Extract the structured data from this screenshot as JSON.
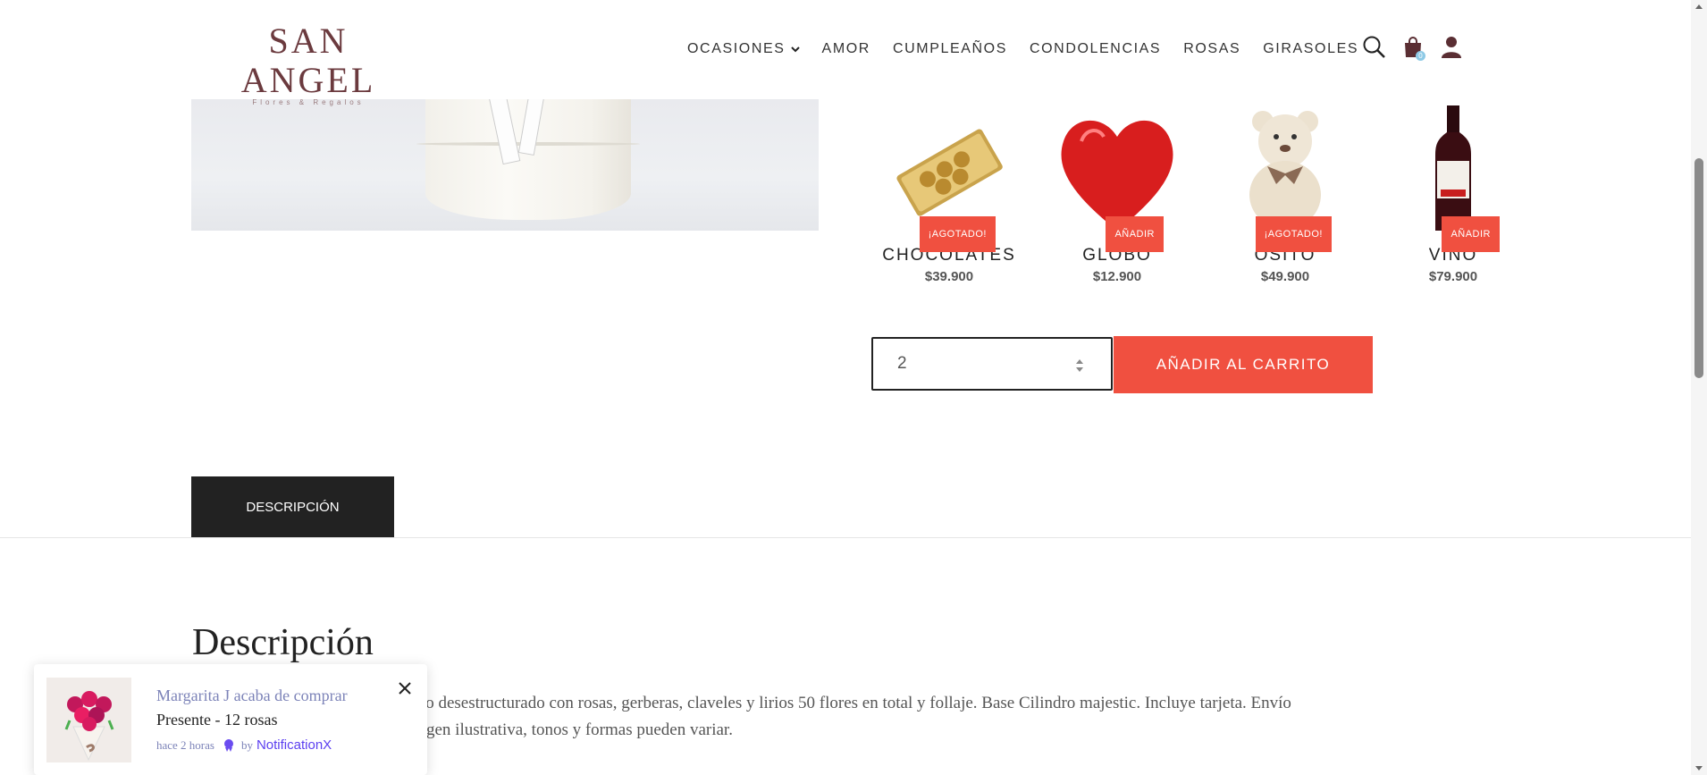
{
  "brand": {
    "name": "SAN ANGEL",
    "tagline": "Flores & Regalos"
  },
  "nav": {
    "items": [
      {
        "label": "OCASIONES",
        "has_dropdown": true
      },
      {
        "label": "AMOR"
      },
      {
        "label": "CUMPLEAÑOS"
      },
      {
        "label": "CONDOLENCIAS"
      },
      {
        "label": "ROSAS"
      },
      {
        "label": "GIRASOLES"
      }
    ],
    "icons": [
      "search-icon",
      "cart-icon",
      "user-icon"
    ],
    "cart_count": "0"
  },
  "addons": [
    {
      "name": "CHOCOLATES",
      "price": "$39.900",
      "badge": "¡AGOTADO!"
    },
    {
      "name": "GLOBO",
      "price": "$12.900",
      "badge": "AÑADIR"
    },
    {
      "name": "OSITO",
      "price": "$49.900",
      "badge": "¡AGOTADO!"
    },
    {
      "name": "VINO",
      "price": "$79.900",
      "badge": "AÑADIR"
    }
  ],
  "purchase": {
    "quantity": "2",
    "add_to_cart_label": "AÑADIR AL CARRITO"
  },
  "tabs": {
    "description_label": "DESCRIPCIÓN"
  },
  "description": {
    "title": "Descripción",
    "line1_visible": "stilo desestructurado con rosas, gerberas, claveles y lirios 50 flores en total y follaje. Base Cilindro majestic. Incluye tarjeta. Envío",
    "line2_visible": "gen ilustrativa, tonos y formas pueden variar."
  },
  "notification": {
    "customer": "Margarita J acaba de comprar",
    "product": "Presente - 12 rosas",
    "time": "hace 2 horas",
    "by": "by",
    "provider": "NotificationX"
  },
  "colors": {
    "accent": "#f05040",
    "brand": "#6b3a3e",
    "tab_active": "#222222",
    "notif_link": "#7c83b8",
    "notif_brand": "#5b3ff0"
  }
}
